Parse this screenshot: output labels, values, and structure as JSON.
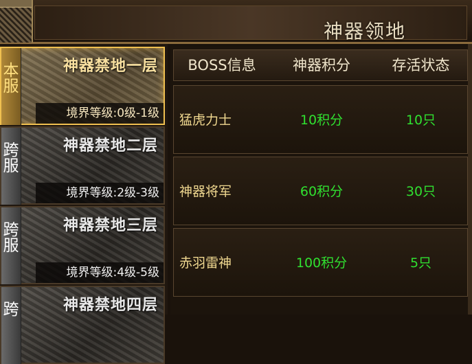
{
  "header": {
    "title": "神器领地"
  },
  "sidebar": {
    "items": [
      {
        "server": "本服",
        "name": "神器禁地一层",
        "level": "境界等级:0级-1级",
        "active": true
      },
      {
        "server": "跨服",
        "name": "神器禁地二层",
        "level": "境界等级:2级-3级",
        "active": false
      },
      {
        "server": "跨服",
        "name": "神器禁地三层",
        "level": "境界等级:4级-5级",
        "active": false
      },
      {
        "server": "跨",
        "name": "神器禁地四层",
        "level": "",
        "active": false
      }
    ]
  },
  "table": {
    "headers": [
      "BOSS信息",
      "神器积分",
      "存活状态"
    ],
    "rows": [
      {
        "name": "猛虎力士",
        "points": "10积分",
        "status": "10只"
      },
      {
        "name": "神器将军",
        "points": "60积分",
        "status": "30只"
      },
      {
        "name": "赤羽雷神",
        "points": "100积分",
        "status": "5只"
      }
    ]
  },
  "colors": {
    "accent_gold": "#f0c050",
    "value_green": "#30e030",
    "boss_name": "#f0d890"
  }
}
